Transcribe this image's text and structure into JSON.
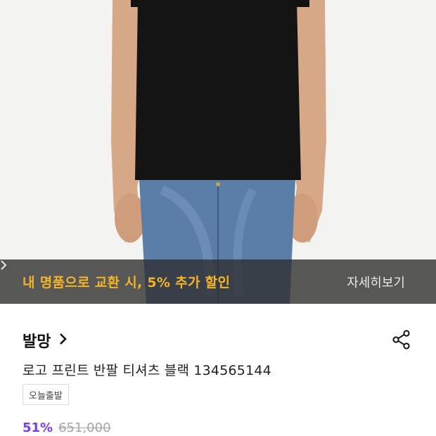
{
  "banner": {
    "promo_text": "내 명품으로 교환 시, 5% 추가 할인",
    "detail_link": "자세히보기"
  },
  "product": {
    "brand": "발망",
    "name": "로고 프린트 반팔 티셔츠 블랙 134565144",
    "tag": "오늘출발",
    "discount": "51%",
    "original_price": "651,000"
  },
  "colors": {
    "promo_accent": "#f5b52a",
    "discount_accent": "#7a3cf0",
    "banner_bg": "#303030"
  },
  "icons": {
    "brand_arrow": "chevron-right-icon",
    "banner_arrow": "chevron-right-icon",
    "share": "share-icon"
  }
}
